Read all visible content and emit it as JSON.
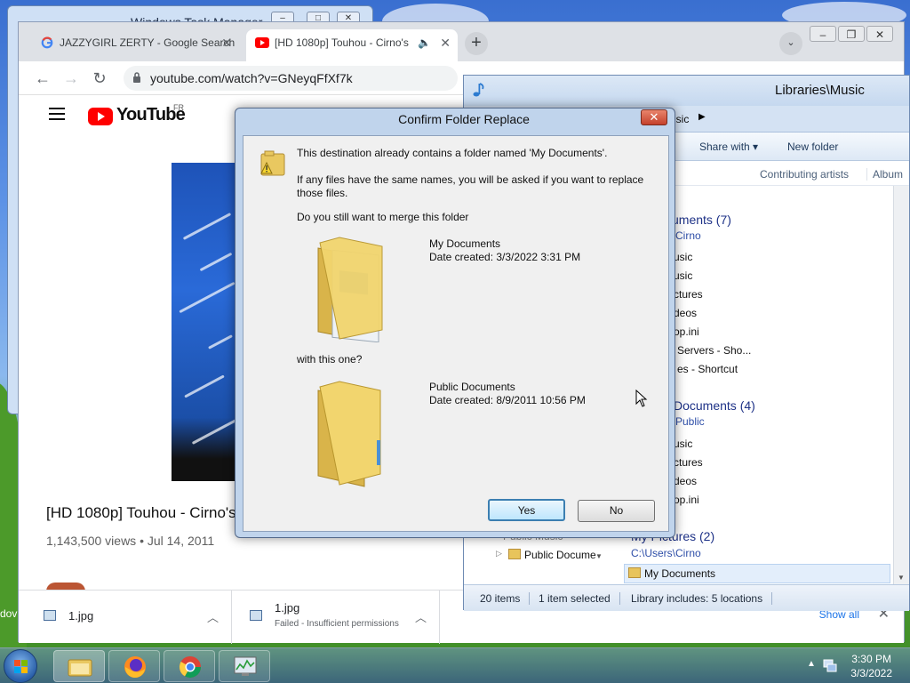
{
  "background_window": {
    "title": "Windows Task Manager"
  },
  "browser": {
    "tabs": [
      {
        "label": "JAZZYGIRL ZERTY - Google Search",
        "active": false,
        "icon": "google-icon"
      },
      {
        "label": "[HD 1080p] Touhou - Cirno's",
        "active": true,
        "icon": "youtube-icon",
        "audio": true
      }
    ],
    "url": "youtube.com/watch?v=GNeyqFfXf7k",
    "page": {
      "brand": "YouTube",
      "region": "FR",
      "video_title": "[HD 1080p] Touhou - Cirno's",
      "video_meta": "1,143,500 views • Jul 14, 2011"
    },
    "downloads": [
      {
        "name": "1.jpg",
        "status": ""
      },
      {
        "name": "1.jpg",
        "status": "Failed - Insufficient permissions"
      }
    ],
    "show_all": "Show all"
  },
  "explorer": {
    "title": "Libraries\\Music",
    "breadcrumb": "usic",
    "commands": [
      "Share with",
      "New folder"
    ],
    "columns": [
      "Contributing artists",
      "Album"
    ],
    "groups": [
      {
        "title": "uments (7)",
        "subtitle": "Cirno",
        "items": [
          "usic",
          "usic",
          "ctures",
          "deos",
          "op.ini",
          "Servers - Sho...",
          "es - Shortcut"
        ]
      },
      {
        "title": "Documents (4)",
        "subtitle": "Public",
        "items": [
          "usic",
          "ctures",
          "deos",
          "op.ini"
        ]
      },
      {
        "title": "My Pictures (2)",
        "subtitle": "C:\\Users\\Cirno",
        "items": []
      }
    ],
    "nav_items": [
      "Public Music",
      "Public Docume"
    ],
    "selected_item": "My Documents",
    "status": {
      "count": "20 items",
      "selected": "1 item selected",
      "library": "Library includes: 5 locations"
    }
  },
  "dialog": {
    "title": "Confirm Folder Replace",
    "message1": "This destination already contains a folder named 'My Documents'.",
    "message2": "If any files have the same names, you will be asked if you want to replace those files.",
    "question": "Do you still want to merge this folder",
    "folder1": {
      "name": "My Documents",
      "date": "Date created: 3/3/2022 3:31 PM"
    },
    "with_text": "with this one?",
    "folder2": {
      "name": "Public Documents",
      "date": "Date created: 8/9/2011 10:56 PM"
    },
    "yes_label": "Yes",
    "no_label": "No"
  },
  "taskbar": {
    "apps": [
      "explorer-icon",
      "firefox-icon",
      "chrome-icon",
      "task-manager-icon"
    ],
    "time": "3:30 PM",
    "date": "3/3/2022"
  },
  "desktop_text": "dov"
}
